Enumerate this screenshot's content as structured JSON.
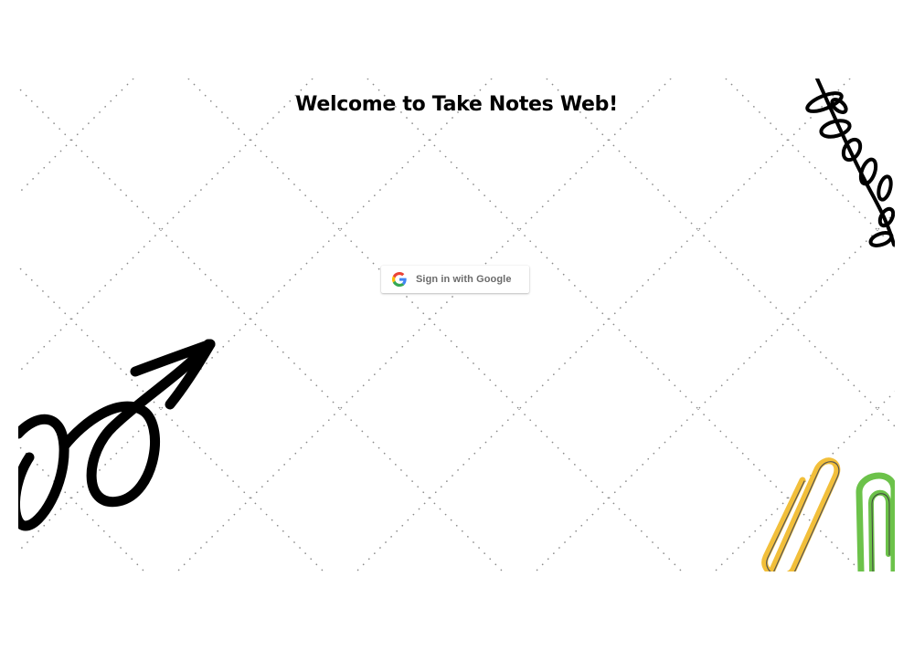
{
  "page": {
    "title": "Welcome to Take Notes Web!"
  },
  "signin": {
    "label": "Sign in with Google",
    "icon": "google-g-icon"
  },
  "decorations": {
    "arrow": "loopy-arrow-doodle",
    "branch": "leaf-branch-doodle",
    "clips": [
      "yellow-paperclip",
      "green-paperclip"
    ]
  },
  "colors": {
    "title": "#000000",
    "button_text": "#6b6b6b",
    "dots": "#8a8a8a",
    "clip_yellow": "#f2bf3a",
    "clip_green": "#6cc24a"
  }
}
